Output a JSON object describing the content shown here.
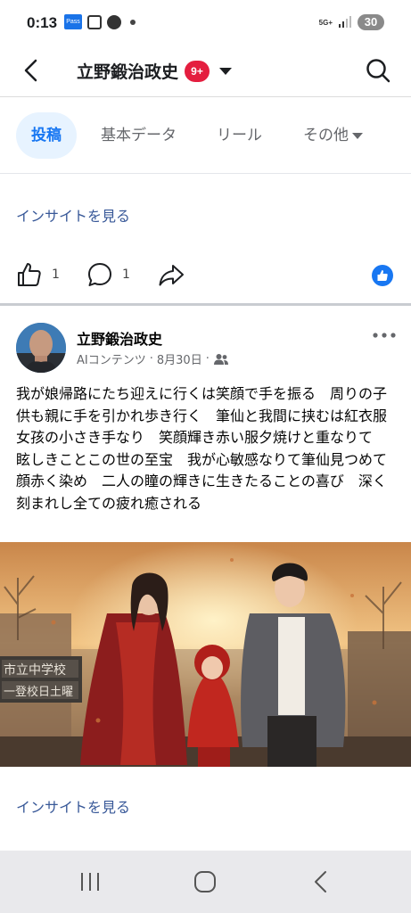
{
  "status": {
    "time": "0:13",
    "pass_label": "Pass",
    "network": "5G+",
    "battery": "30"
  },
  "header": {
    "title": "立野鍛治政史",
    "badge": "9+"
  },
  "tabs": [
    {
      "label": "投稿",
      "active": true
    },
    {
      "label": "基本データ",
      "active": false
    },
    {
      "label": "リール",
      "active": false
    },
    {
      "label": "その他",
      "active": false,
      "has_dropdown": true
    }
  ],
  "prev_post": {
    "insight_link": "インサイトを見る",
    "like_count": "1",
    "comment_count": "1"
  },
  "post": {
    "author": "立野鍛治政史",
    "content_label": "AIコンテンツ",
    "date": "8月30日",
    "body": "我が娘帰路にたち迎えに行くは笑顔で手を振る　周りの子供も親に手を引かれ歩き行く　筆仙と我間に挟むは紅衣服女孩の小さき手なり　笑顔輝き赤い服夕焼けと重なりて　眩しきことこの世の至宝　我が心敏感なりて筆仙見つめて顔赤く染め　二人の瞳の輝きに生きたることの喜び　深く刻まれし全ての疲れ癒される",
    "image_sign": [
      "市立中学校",
      "一登校日土曜"
    ],
    "insight_link": "インサイトを見る"
  },
  "colors": {
    "accent": "#1877f2",
    "link": "#385898",
    "badge": "#e41e3f",
    "active_tab_bg": "#e7f3ff"
  }
}
